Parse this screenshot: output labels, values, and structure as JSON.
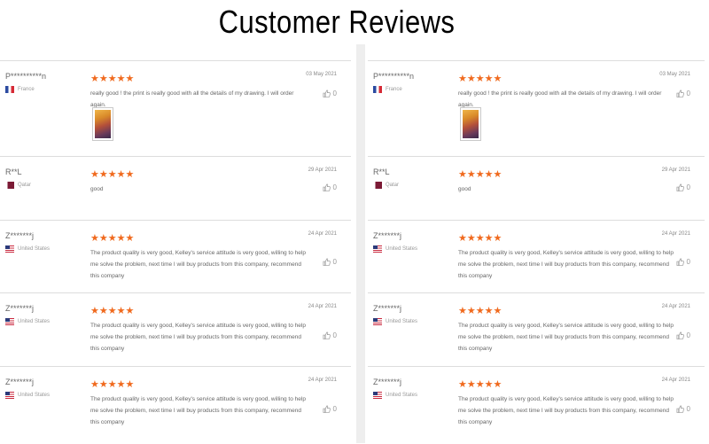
{
  "title": "Customer Reviews",
  "reviews": [
    {
      "name": "P**********n",
      "country": "France",
      "flag": "fr",
      "stars": "★★★★★",
      "date": "03 May 2021",
      "text": "really good ! the print is really good with all the details of my drawing. I will order again.",
      "likes": "0",
      "has_photo": true
    },
    {
      "name": "R**L",
      "country": "Qatar",
      "flag": "qa",
      "stars": "★★★★★",
      "date": "29 Apr 2021",
      "text": "good",
      "likes": "0",
      "has_photo": false
    },
    {
      "name": "Z*******j",
      "country": "United States",
      "flag": "us",
      "stars": "★★★★★",
      "date": "24 Apr 2021",
      "text": "The product quality is very good, Kelley's service attitude is very good, willing to help me solve the problem, next time I will buy products from this company, recommend this company",
      "likes": "0",
      "has_photo": false
    },
    {
      "name": "Z*******j",
      "country": "United States",
      "flag": "us",
      "stars": "★★★★★",
      "date": "24 Apr 2021",
      "text": "The product quality is very good, Kelley's service attitude is very good, willing to help me solve the problem, next time I will buy products from this company, recommend this company",
      "likes": "0",
      "has_photo": false
    },
    {
      "name": "Z*******j",
      "country": "United States",
      "flag": "us",
      "stars": "★★★★★",
      "date": "24 Apr 2021",
      "text": "The product quality is very good, Kelley's service attitude is very good, willing to help me solve the problem, next time I will buy products from this company, recommend this company",
      "likes": "0",
      "has_photo": false
    }
  ],
  "colors": {
    "star": "#f06a1e",
    "divider": "#eeeeee"
  },
  "icons": {
    "like": "thumbs-up-icon",
    "photo": "review-photo-thumbnail"
  }
}
